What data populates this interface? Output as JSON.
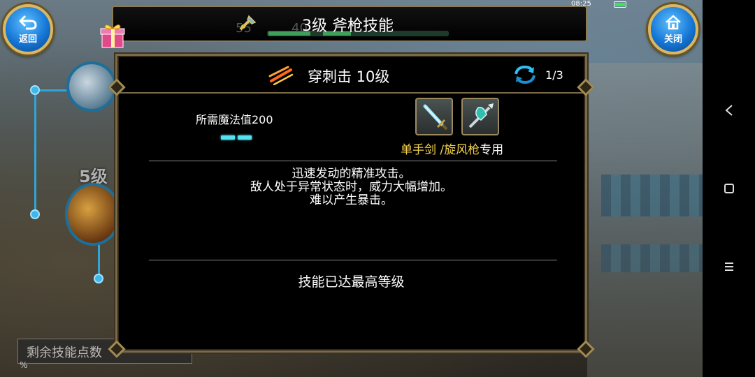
{
  "status_bar": {
    "time": "08:25"
  },
  "top_bar": {
    "title": "3级 斧枪技能",
    "ghost_values": [
      "55",
      "40"
    ]
  },
  "buttons": {
    "back_label": "返回",
    "close_label": "关闭"
  },
  "skill_tree": {
    "level_label": "5级",
    "remaining_points_label": "剩余技能点数",
    "progress_suffix": "%"
  },
  "dialog": {
    "skill_name": "穿刺击 10级",
    "page": "1/3",
    "mana_label": "所需魔法值200",
    "mana_pips": 2,
    "weapon_note_prefix": "单手剑 /旋风枪",
    "weapon_note_suffix": "专用",
    "description": [
      "迅速发动的精准攻击。",
      "敌人处于异常状态时，威力大幅增加。",
      "难以产生暴击。"
    ],
    "max_level_text": "技能已达最高等级"
  },
  "colors": {
    "accent_gold": "#f3d24a",
    "mana_cyan": "#55e1ef",
    "frame_bronze": "#7a6a48",
    "button_blue": "#1677d6"
  },
  "icons": [
    "back-arrow-icon",
    "home-icon",
    "gift-icon",
    "skill-slash-icon",
    "refresh-cycle-icon",
    "sword-icon",
    "axe-spear-icon",
    "nav-back-icon",
    "nav-home-icon",
    "nav-menu-icon"
  ]
}
